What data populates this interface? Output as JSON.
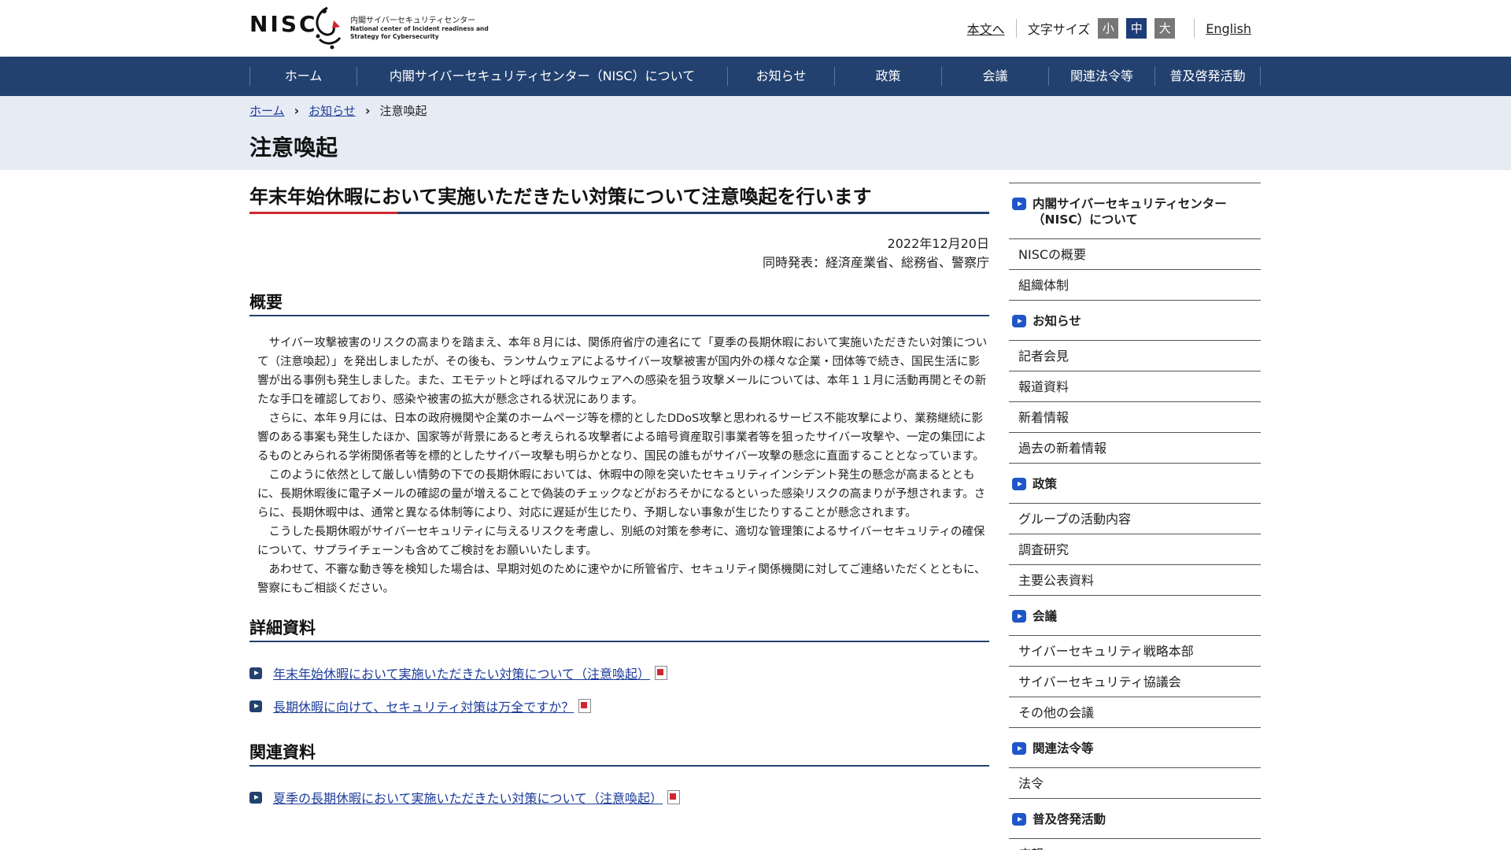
{
  "header": {
    "logo_mark": "NISC",
    "logo_jp": "内閣サイバーセキュリティセンター",
    "logo_en_1": "National center of Incident readiness and",
    "logo_en_2": "Strategy for Cybersecurity",
    "skip_link": "本文へ",
    "font_size_label": "文字サイズ",
    "font_size_small": "小",
    "font_size_medium": "中",
    "font_size_large": "大",
    "english_link": "English"
  },
  "nav": {
    "items": [
      {
        "label": "ホーム"
      },
      {
        "label": "内閣サイバーセキュリティセンター（NISC）について"
      },
      {
        "label": "お知らせ"
      },
      {
        "label": "政策"
      },
      {
        "label": "会議"
      },
      {
        "label": "関連法令等"
      },
      {
        "label": "普及啓発活動"
      }
    ]
  },
  "breadcrumb": {
    "home": "ホーム",
    "news": "お知らせ",
    "current": "注意喚起"
  },
  "page_title": "注意喚起",
  "article": {
    "title": "年末年始休暇において実施いただきたい対策について注意喚起を行います",
    "date": "2022年12月20日",
    "joint": "同時発表：経済産業省、総務省、警察庁",
    "overview_heading": "概要",
    "paragraphs": [
      "サイバー攻撃被害のリスクの高まりを踏まえ、本年８月には、関係府省庁の連名にて「夏季の長期休暇において実施いただきたい対策について（注意喚起）」を発出しましたが、その後も、ランサムウェアによるサイバー攻撃被害が国内外の様々な企業・団体等で続き、国民生活に影響が出る事例も発生しました。また、エモテットと呼ばれるマルウェアへの感染を狙う攻撃メールについては、本年１１月に活動再開とその新たな手口を確認しており、感染や被害の拡大が懸念される状況にあります。",
      "さらに、本年９月には、日本の政府機関や企業のホームページ等を標的としたDDoS攻撃と思われるサービス不能攻撃により、業務継続に影響のある事案も発生したほか、国家等が背景にあると考えられる攻撃者による暗号資産取引事業者等を狙ったサイバー攻撃や、一定の集団によるものとみられる学術関係者等を標的としたサイバー攻撃も明らかとなり、国民の誰もがサイバー攻撃の懸念に直面することとなっています。",
      "このように依然として厳しい情勢の下での長期休暇においては、休暇中の隙を突いたセキュリティインシデント発生の懸念が高まるとともに、長期休暇後に電子メールの確認の量が増えることで偽装のチェックなどがおろそかになるといった感染リスクの高まりが予想されます。さらに、長期休暇中は、通常と異なる体制等により、対応に遅延が生じたり、予期しない事象が生じたりすることが懸念されます。",
      "こうした長期休暇がサイバーセキュリティに与えるリスクを考慮し、別紙の対策を参考に、適切な管理策によるサイバーセキュリティの確保について、サプライチェーンも含めてご検討をお願いいたします。",
      "あわせて、不審な動き等を検知した場合は、早期対処のために速やかに所管省庁、セキュリティ関係機関に対してご連絡いただくとともに、警察にもご相談ください。"
    ],
    "details_heading": "詳細資料",
    "details_links": [
      {
        "label": "年末年始休暇において実施いただきたい対策について（注意喚起）"
      },
      {
        "label": "長期休暇に向けて、セキュリティ対策は万全ですか？"
      }
    ],
    "related_heading": "関連資料",
    "related_links": [
      {
        "label": "夏季の長期休暇において実施いただきたい対策について（注意喚起）"
      }
    ]
  },
  "sidebar": {
    "sections": [
      {
        "title": "内閣サイバーセキュリティセンター（NISC）について",
        "items": [
          "NISCの概要",
          "組織体制"
        ]
      },
      {
        "title": "お知らせ",
        "items": [
          "記者会見",
          "報道資料",
          "新着情報",
          "過去の新着情報"
        ]
      },
      {
        "title": "政策",
        "items": [
          "グループの活動内容",
          "調査研究",
          "主要公表資料"
        ]
      },
      {
        "title": "会議",
        "items": [
          "サイバーセキュリティ戦略本部",
          "サイバーセキュリティ協議会",
          "その他の会議"
        ]
      },
      {
        "title": "関連法令等",
        "items": [
          "法令"
        ]
      },
      {
        "title": "普及啓発活動",
        "items": [
          "広報"
        ]
      }
    ]
  }
}
